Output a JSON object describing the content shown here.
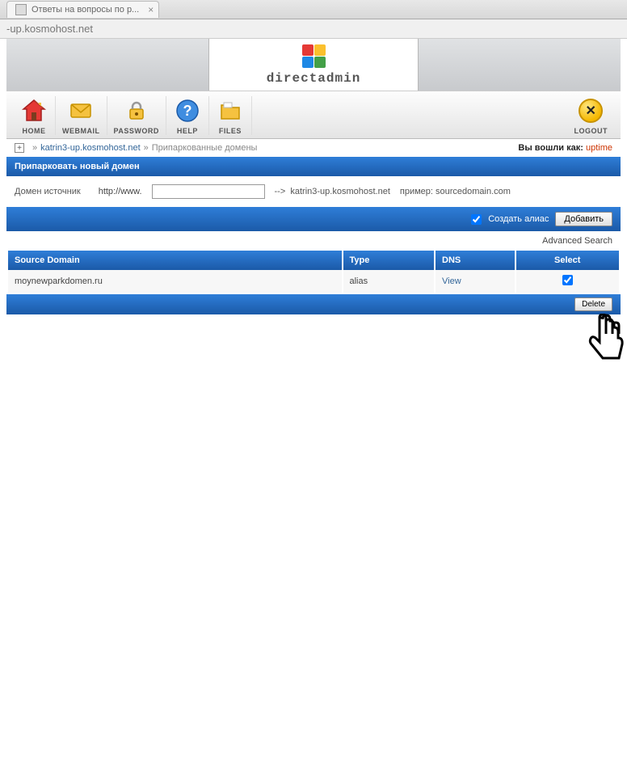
{
  "browser": {
    "tab_title": "Ответы на вопросы по р...",
    "address": "-up.kosmohost.net"
  },
  "logo_text": "directadmin",
  "nav": {
    "home": "HOME",
    "webmail": "WEBMAIL",
    "password": "PASSWORD",
    "help": "HELP",
    "files": "FILES",
    "logout": "LOGOUT"
  },
  "breadcrumb": {
    "link": "katrin3-up.kosmohost.net",
    "current": "Припаркованные домены",
    "logged_in_label": "Вы вошли как:",
    "user": "uptime"
  },
  "sections": {
    "park_new": "Припарковать новый домен",
    "source_label": "Домен источник",
    "prefix": "http://www.",
    "arrow": "-->",
    "target_domain": "katrin3-up.kosmohost.net",
    "example": "пример: sourcedomain.com",
    "create_alias": "Создать алиас",
    "add_btn": "Добавить"
  },
  "adv_search": "Advanced Search",
  "table": {
    "headers": {
      "source": "Source Domain",
      "type": "Type",
      "dns": "DNS",
      "select": "Select"
    },
    "rows": [
      {
        "source": "moynewparkdomen.ru",
        "type": "alias",
        "dns": "View",
        "selected": true
      }
    ]
  },
  "delete_btn": "Delete"
}
